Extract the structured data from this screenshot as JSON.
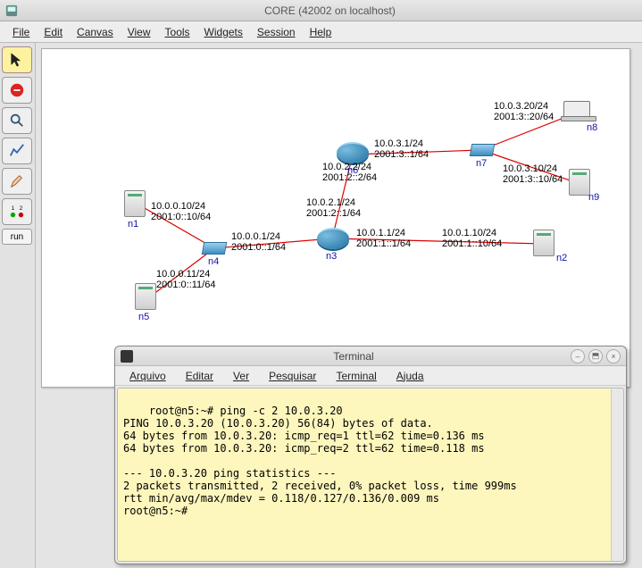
{
  "window": {
    "title": "CORE (42002 on localhost)"
  },
  "menu": {
    "file": "File",
    "edit": "Edit",
    "canvas": "Canvas",
    "view": "View",
    "tools": "Tools",
    "widgets": "Widgets",
    "session": "Session",
    "help": "Help"
  },
  "toolbar": {
    "run_label": "run"
  },
  "nodes": {
    "n1": "n1",
    "n2": "n2",
    "n3": "n3",
    "n4": "n4",
    "n5": "n5",
    "n6": "n6",
    "n7": "n7",
    "n8": "n8",
    "n9": "n9"
  },
  "labels": {
    "n1_addr": "10.0.0.10/24\n2001:0::10/64",
    "n5_addr": "10.0.0.11/24\n2001:0::11/64",
    "n4_eth0": "10.0.0.1/24\n2001:0::1/64",
    "n3_eth0": "10.0.1.1/24\n2001:1::1/64",
    "n2_addr": "10.0.1.10/24\n2001:1::10/64",
    "n3_eth1": "10.0.2.1/24\n2001:2::1/64",
    "n6_eth1": "10.0.2.2/24\n2001:2::2/64",
    "n6_eth0": "10.0.3.1/24\n2001:3::1/64",
    "n8_addr": "10.0.3.20/24\n2001:3::20/64",
    "n9_addr": "10.0.3.10/24\n2001:3::10/64"
  },
  "terminal": {
    "title": "Terminal",
    "menu": {
      "arquivo": "Arquivo",
      "editar": "Editar",
      "ver": "Ver",
      "pesquisar": "Pesquisar",
      "terminal": "Terminal",
      "ajuda": "Ajuda"
    },
    "content": "root@n5:~# ping -c 2 10.0.3.20\nPING 10.0.3.20 (10.0.3.20) 56(84) bytes of data.\n64 bytes from 10.0.3.20: icmp_req=1 ttl=62 time=0.136 ms\n64 bytes from 10.0.3.20: icmp_req=2 ttl=62 time=0.118 ms\n\n--- 10.0.3.20 ping statistics ---\n2 packets transmitted, 2 received, 0% packet loss, time 999ms\nrtt min/avg/max/mdev = 0.118/0.127/0.136/0.009 ms\nroot@n5:~# "
  }
}
